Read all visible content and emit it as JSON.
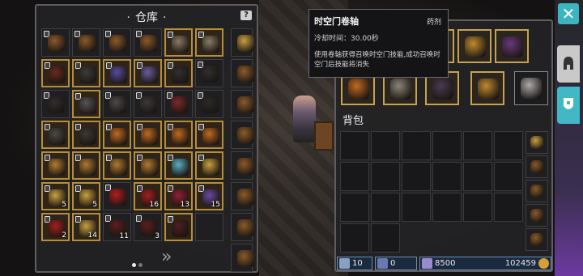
{
  "storage": {
    "title": "仓库",
    "help_icon": "?",
    "rows": [
      [
        {
          "icon": "bag-icon",
          "lock": true,
          "c": "#8a5a2a"
        },
        {
          "icon": "bag-icon",
          "lock": true,
          "c": "#8a5a2a"
        },
        {
          "icon": "bag-icon",
          "lock": true,
          "c": "#8a5a2a"
        },
        {
          "icon": "bag-icon",
          "lock": true,
          "c": "#8a5a2a"
        },
        {
          "icon": "sword-icon",
          "lock": true,
          "gold": true,
          "c": "#8a7a64"
        },
        {
          "icon": "sword-icon",
          "lock": true,
          "gold": true,
          "c": "#8a7a64"
        }
      ],
      [
        {
          "icon": "spear-icon",
          "lock": true,
          "gold": true,
          "c": "#6a2a1e"
        },
        {
          "icon": "spear-icon",
          "lock": true,
          "gold": true,
          "c": "#3c3c3c"
        },
        {
          "icon": "robe-icon",
          "lock": true,
          "gold": true,
          "c": "#5a4aa0"
        },
        {
          "icon": "cloak-icon",
          "lock": true,
          "gold": true,
          "c": "#6a5a9a"
        },
        {
          "icon": "helmet-icon",
          "lock": true,
          "gold": true,
          "c": "#303030"
        },
        {
          "icon": "helmet-icon",
          "lock": true,
          "c": "#303030"
        }
      ],
      [
        {
          "icon": "armor-icon",
          "lock": true,
          "c": "#2e2e30"
        },
        {
          "icon": "armor-icon",
          "lock": true,
          "gold": true,
          "c": "#555"
        },
        {
          "icon": "armor-icon",
          "lock": true,
          "c": "#4a4a4a"
        },
        {
          "icon": "armor-icon",
          "lock": true,
          "c": "#3a3a3a"
        },
        {
          "icon": "armor-icon",
          "lock": true,
          "c": "#7a2a2a"
        },
        {
          "icon": "armor-icon",
          "lock": true,
          "c": "#2a2a2a"
        }
      ],
      [
        {
          "icon": "wand-icon",
          "lock": true,
          "gold": true,
          "c": "#4a4a48"
        },
        {
          "icon": "bow-icon",
          "lock": true,
          "gold": true,
          "c": "#3a3a38"
        },
        {
          "icon": "amulet-icon",
          "lock": true,
          "gold": true,
          "c": "#c06a20"
        },
        {
          "icon": "amulet-icon",
          "lock": true,
          "gold": true,
          "c": "#c06a20"
        },
        {
          "icon": "amulet-icon",
          "lock": true,
          "gold": true,
          "c": "#c06a20"
        },
        {
          "icon": "amulet-icon",
          "lock": true,
          "gold": true,
          "c": "#c06a20"
        }
      ],
      [
        {
          "icon": "ring-icon",
          "lock": true,
          "gold": true,
          "c": "#b07a30"
        },
        {
          "icon": "ring-icon",
          "lock": true,
          "gold": true,
          "c": "#b07a30"
        },
        {
          "icon": "ring-icon",
          "lock": true,
          "gold": true,
          "c": "#b07a30"
        },
        {
          "icon": "ring-icon",
          "lock": true,
          "gold": true,
          "c": "#b07a30"
        },
        {
          "icon": "gem-icon",
          "lock": true,
          "gold": true,
          "c": "#5ab0c0"
        },
        {
          "icon": "scroll-icon",
          "lock": true,
          "gold": true,
          "c": "#c8a040"
        }
      ],
      [
        {
          "icon": "scroll-icon",
          "lock": true,
          "gold": true,
          "c": "#c8a040",
          "count": "5"
        },
        {
          "icon": "scroll-icon",
          "lock": true,
          "gold": true,
          "c": "#c8a040",
          "count": "5"
        },
        {
          "icon": "flower-icon",
          "lock": true,
          "c": "#b02020"
        },
        {
          "icon": "flower-icon",
          "lock": true,
          "gold": true,
          "c": "#a02020",
          "count": "16"
        },
        {
          "icon": "flower-icon",
          "lock": true,
          "gold": true,
          "c": "#902030",
          "count": "13"
        },
        {
          "icon": "crystal-icon",
          "lock": true,
          "gold": true,
          "c": "#6a4aa0",
          "count": "15"
        }
      ],
      [
        {
          "icon": "heart-icon",
          "lock": true,
          "gold": true,
          "c": "#a02020",
          "count": "2"
        },
        {
          "icon": "tome-icon",
          "lock": true,
          "gold": true,
          "c": "#c8a040",
          "count": "14"
        },
        {
          "icon": "claw-icon",
          "lock": true,
          "c": "#5a2020",
          "count": "11"
        },
        {
          "icon": "claw-icon",
          "lock": true,
          "c": "#5a2020",
          "count": "3"
        },
        {
          "icon": "claw-icon",
          "lock": true,
          "gold": true,
          "c": "#4a2020"
        },
        {
          "empty": true
        }
      ]
    ],
    "side_items": [
      {
        "icon": "shrine-icon",
        "c": "#c8a040"
      },
      {
        "icon": "bag-icon",
        "c": "#8a5a2a"
      },
      {
        "icon": "bag-icon",
        "c": "#8a5a2a"
      },
      {
        "icon": "bag-icon",
        "c": "#8a5a2a"
      },
      {
        "icon": "bag-icon",
        "c": "#8a5a2a"
      },
      {
        "icon": "bag-icon",
        "c": "#8a5a2a"
      },
      {
        "icon": "bag-icon",
        "c": "#8a5a2a"
      },
      {
        "icon": "bag-icon",
        "c": "#8a5a2a"
      }
    ]
  },
  "tooltip": {
    "title": "时空门卷轴",
    "type": "药剂",
    "cooldown": "冷却时间：30.00秒",
    "description": "使用卷轴获得召唤时空门技能,成功召唤时空门后技能将消失"
  },
  "bag": {
    "title": "背包",
    "equip_top": [
      {
        "icon": "boots-icon",
        "c": "#6a3a3a"
      },
      {
        "icon": "ring-icon",
        "c": "#c08a30"
      },
      {
        "icon": "staff-icon",
        "c": "#6a3a7a"
      }
    ],
    "equip_bottom": [
      {
        "icon": "amulet-icon",
        "c": "#c06a20"
      },
      {
        "icon": "gloves-icon",
        "c": "#8a8478"
      },
      {
        "icon": "boots-icon",
        "c": "#4a3a50"
      },
      {
        "icon": "ring-icon",
        "c": "#c08a30"
      },
      {
        "icon": "sword-icon",
        "c": "#aaa"
      }
    ],
    "side_items": [
      {
        "icon": "shrine-icon",
        "c": "#c8a040"
      },
      {
        "icon": "bag-icon",
        "c": "#8a5a2a"
      },
      {
        "icon": "bag-icon",
        "c": "#8a5a2a"
      },
      {
        "icon": "bag-icon",
        "c": "#8a5a2a"
      },
      {
        "icon": "bag-icon",
        "c": "#8a5a2a"
      }
    ]
  },
  "status": {
    "attack": "10",
    "defense": "0",
    "crystals": "8500",
    "gold": "102459"
  },
  "controls": {
    "close": "✕",
    "next": "»"
  },
  "colors": {
    "accent": "#41b8c4",
    "gold_border": "#b88d3a"
  }
}
